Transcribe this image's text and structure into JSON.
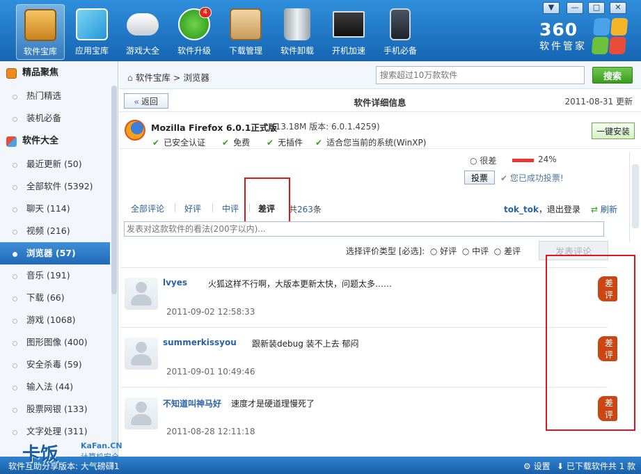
{
  "window_controls": {
    "menu": "▼",
    "minimize": "—",
    "maximize": "□",
    "close": "✕"
  },
  "toolbar": {
    "items": [
      {
        "label": "软件宝库",
        "icon": "treasure-chest-icon",
        "active": true
      },
      {
        "label": "应用宝库",
        "icon": "app-store-icon"
      },
      {
        "label": "游戏大全",
        "icon": "gamepad-icon"
      },
      {
        "label": "软件升级",
        "icon": "upgrade-arrow-icon",
        "badge": "4"
      },
      {
        "label": "下载管理",
        "icon": "download-box-icon"
      },
      {
        "label": "软件卸载",
        "icon": "trash-can-icon"
      },
      {
        "label": "开机加速",
        "icon": "startup-terminal-icon"
      },
      {
        "label": "手机必备",
        "icon": "mobile-phone-icon"
      }
    ]
  },
  "brand": {
    "name": "360",
    "subtitle": "软件管家"
  },
  "sidebar": {
    "sections": [
      {
        "title": "精品聚焦",
        "items": [
          "热门精选",
          "装机必备"
        ]
      },
      {
        "title": "软件大全",
        "items": [
          "最近更新 (50)",
          "全部软件 (5392)",
          "聊天 (114)",
          "视频 (216)",
          "浏览器 (57)",
          "音乐 (191)",
          "下载 (66)",
          "游戏 (1068)",
          "图形图像 (400)",
          "安全杀毒 (59)",
          "输入法 (44)",
          "股票网银 (133)",
          "文字处理 (311)"
        ]
      }
    ],
    "selected": "浏览器 (57)"
  },
  "breadcrumb": {
    "root": "软件宝库",
    "separator": ">",
    "current": "浏览器"
  },
  "search": {
    "placeholder": "搜索超过10万款软件",
    "button": "搜索"
  },
  "detail": {
    "back": "返回",
    "title": "软件详细信息",
    "date": "2011-08-31 更新"
  },
  "app": {
    "name": "Mozilla Firefox 6.0.1正式版",
    "meta": "(13.18M   版本: 6.0.1.4259)",
    "tags": [
      "已安全认证",
      "免费",
      "无插件",
      "适合您当前的系统(WinXP)"
    ],
    "install": "一键安装"
  },
  "vote": {
    "option": "很差",
    "percent": 24,
    "percent_label": "24%",
    "button": "投票",
    "success": "您已成功投票!"
  },
  "review_tabs": {
    "tabs": [
      "全部评论",
      "好评",
      "中评",
      "差评"
    ],
    "active": "差评",
    "count_prefix": "共",
    "count": "263",
    "count_suffix": "条"
  },
  "user": {
    "name": "tok_tok",
    "logout": "，退出登录",
    "refresh": "刷新"
  },
  "comment_form": {
    "placeholder": "发表对这款软件的看法(200字以内)...",
    "type_label": "选择评价类型 [必选]:",
    "types": [
      "好评",
      "中评",
      "差评"
    ],
    "submit": "发表评论"
  },
  "comments": [
    {
      "user": "lvyes",
      "text": "火狐这样不行啊，大版本更新太快，问题太多……",
      "time": "2011-09-02 12:58:33",
      "badge": "差评"
    },
    {
      "user": "summerkissyou",
      "text": "跟新装debug 装不上去  郁闷",
      "time": "2011-09-01 10:49:46",
      "badge": "差评"
    },
    {
      "user": "不知道叫神马好",
      "text": "速度才是硬道理慢死了",
      "time": "2011-08-28 12:11:18",
      "badge": "差评"
    }
  ],
  "statusbar": {
    "version": "软件互助分享版本: 大气磅礴1",
    "settings": "设置",
    "downloaded": "已下载软件共 1 款"
  },
  "watermark": {
    "logo": "卡饭",
    "site": "KaFan.CN",
    "tagline": "计算机安全"
  }
}
